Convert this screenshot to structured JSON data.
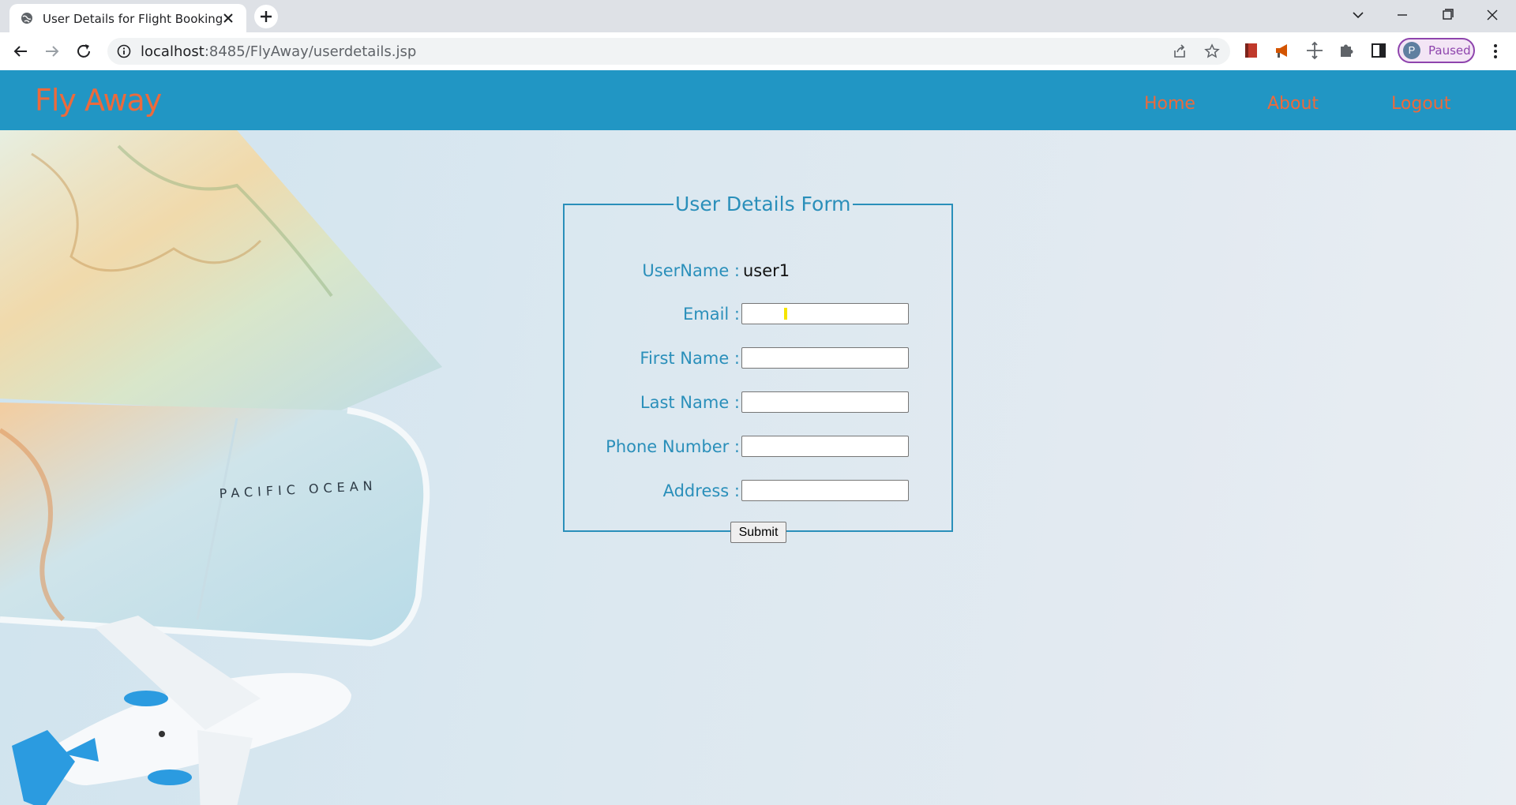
{
  "browser": {
    "tab_title": "User Details for Flight Booking",
    "url_host": "localhost",
    "url_rest": ":8485/FlyAway/userdetails.jsp",
    "profile_initial": "P",
    "profile_status": "Paused"
  },
  "site": {
    "brand": "Fly Away",
    "nav": {
      "home": "Home",
      "about": "About",
      "logout": "Logout"
    },
    "colors": {
      "navbar": "#2196c4",
      "brand": "#ec6a3c",
      "form_accent": "#2a8fba"
    }
  },
  "form": {
    "legend": "User Details Form",
    "username_label": "UserName :",
    "username_value": "user1",
    "email_label": "Email :",
    "email_value": "",
    "first_name_label": "First Name :",
    "first_name_value": "",
    "last_name_label": "Last Name :",
    "last_name_value": "",
    "phone_label": "Phone Number :",
    "phone_value": "",
    "address_label": "Address :",
    "address_value": "",
    "submit_label": "Submit"
  },
  "background": {
    "map_text": "PACIFIC OCEAN"
  }
}
